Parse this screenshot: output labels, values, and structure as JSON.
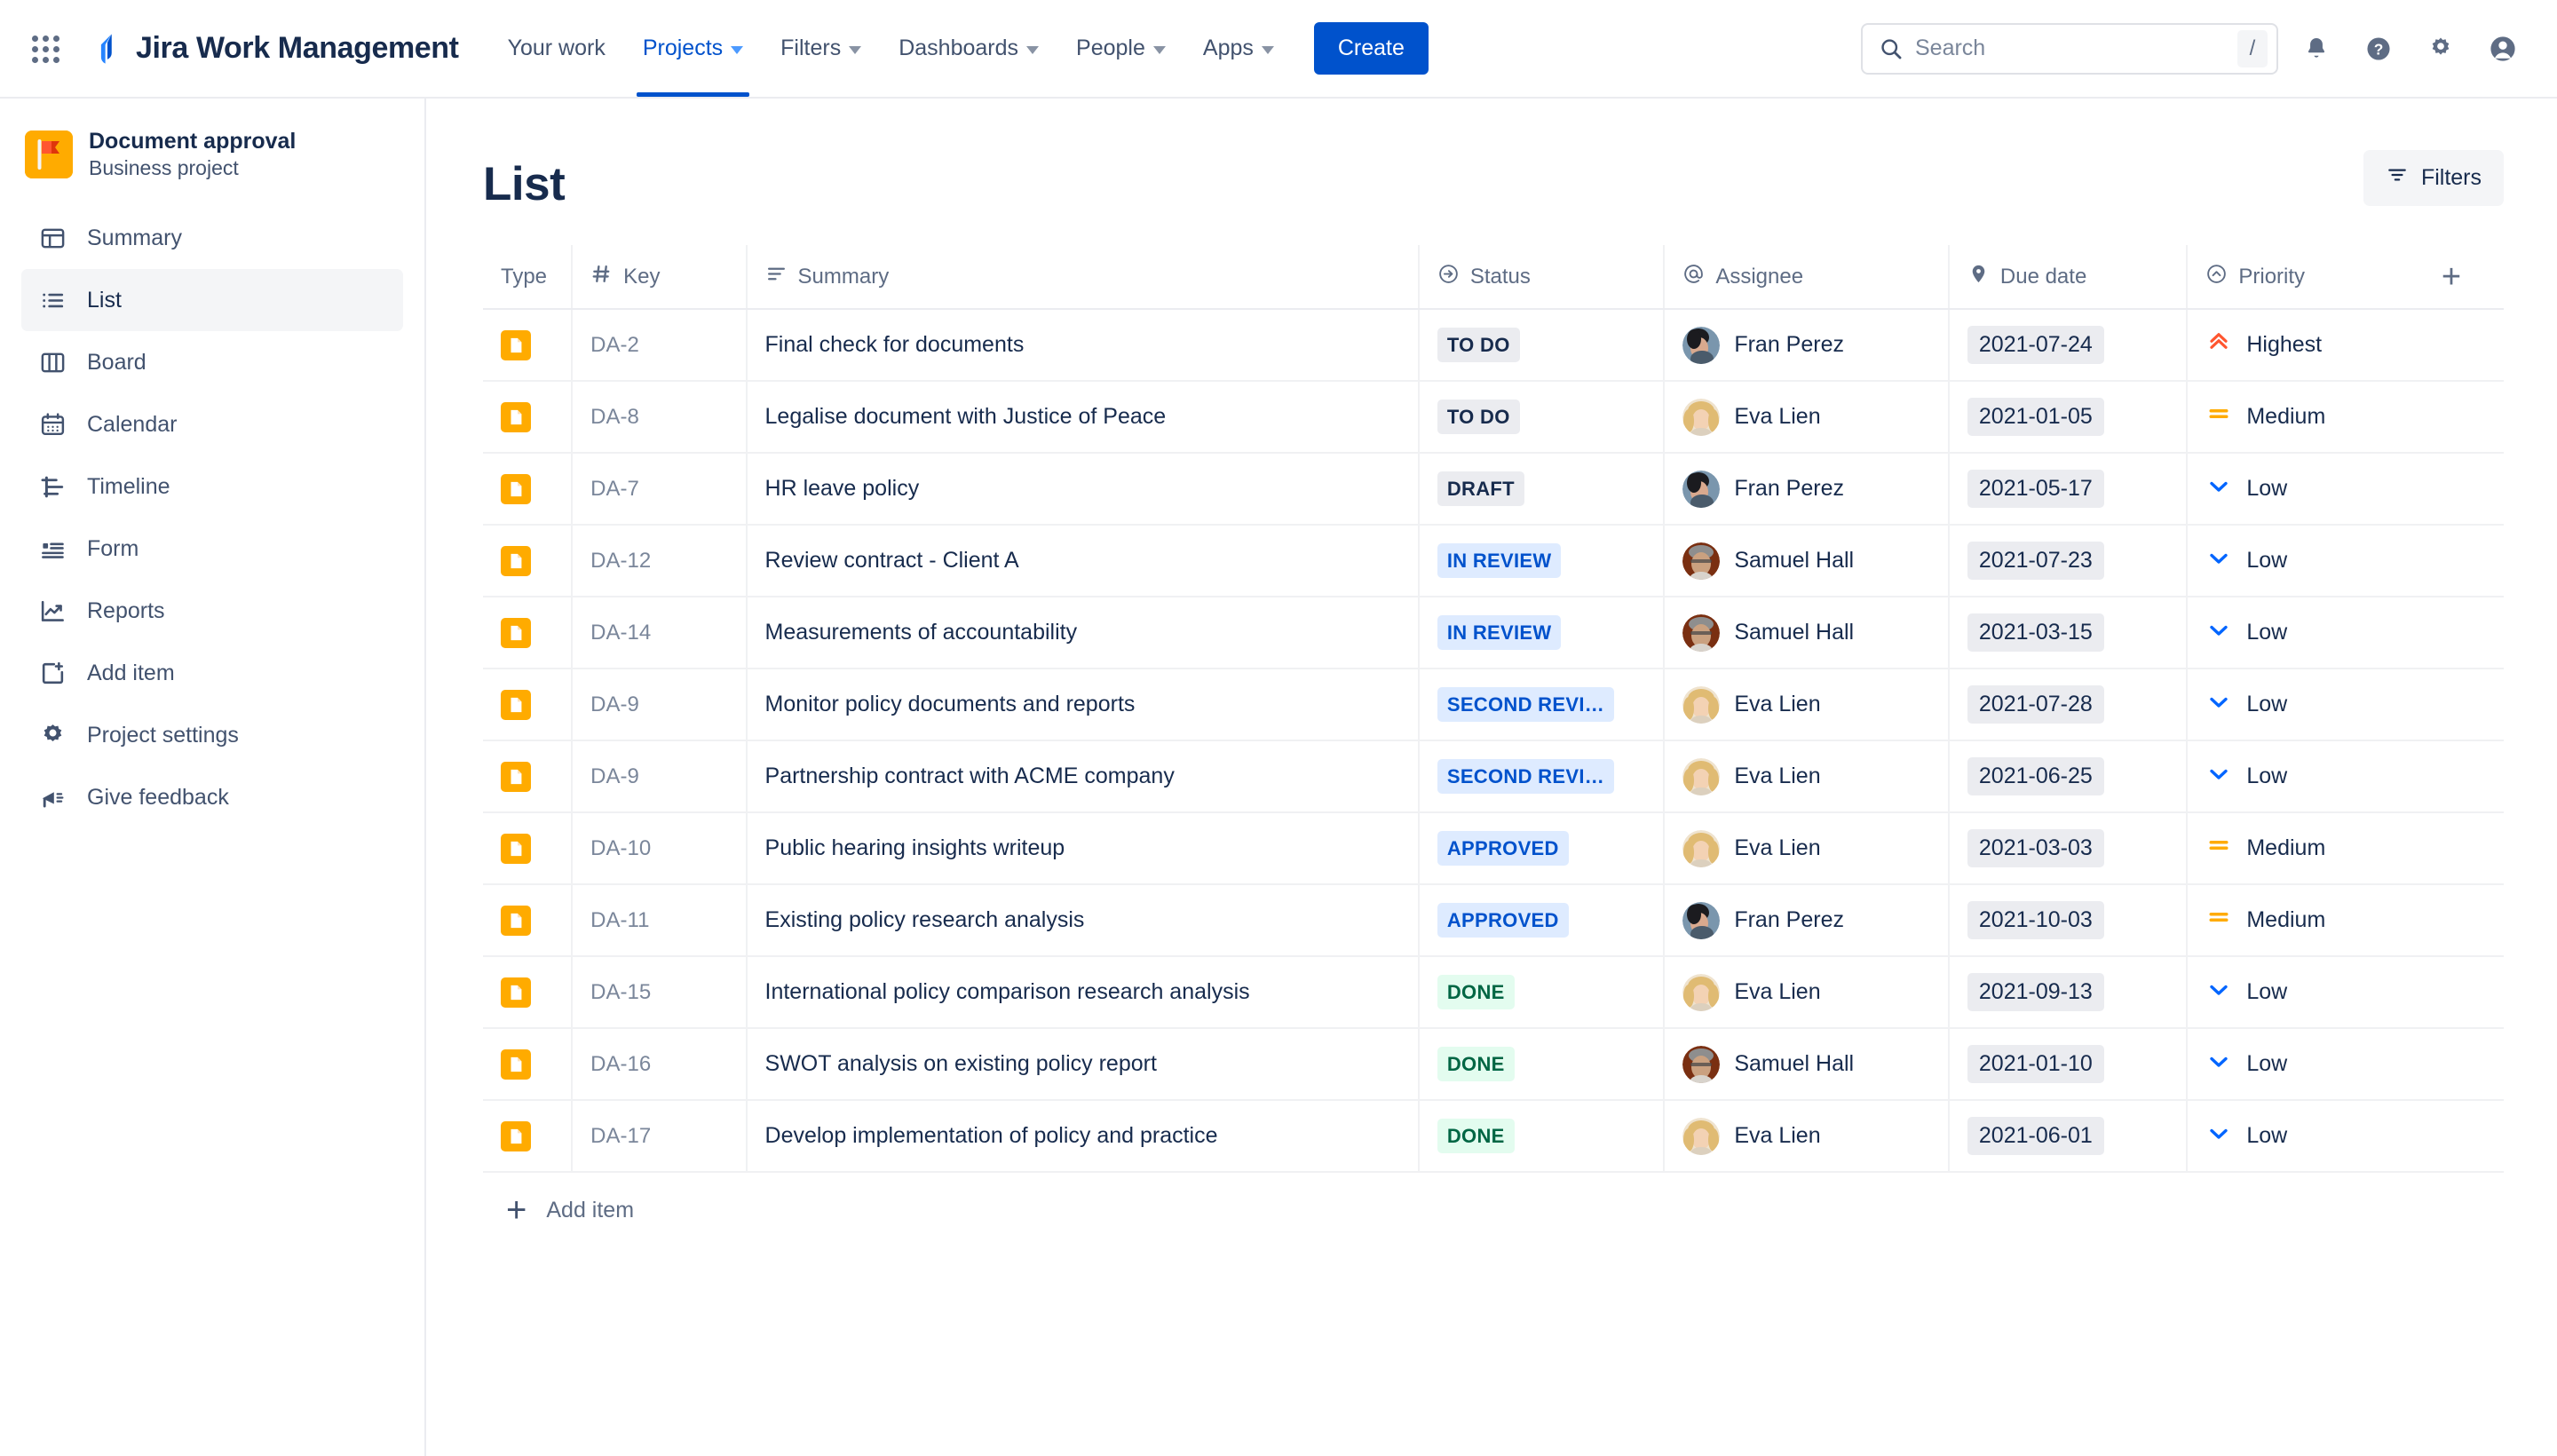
{
  "topnav": {
    "app_switcher_icon": "grid-apps-icon",
    "brand": "Jira Work Management",
    "brand_icon": "jira-logo-icon",
    "items": [
      {
        "label": "Your work",
        "has_caret": false,
        "active": false
      },
      {
        "label": "Projects",
        "has_caret": true,
        "active": true
      },
      {
        "label": "Filters",
        "has_caret": true,
        "active": false
      },
      {
        "label": "Dashboards",
        "has_caret": true,
        "active": false
      },
      {
        "label": "People",
        "has_caret": true,
        "active": false
      },
      {
        "label": "Apps",
        "has_caret": true,
        "active": false
      }
    ],
    "create_label": "Create",
    "search": {
      "placeholder": "Search",
      "value": "",
      "icon": "search-icon",
      "shortcut": "/"
    },
    "right_icons": [
      {
        "name": "notifications-bell-icon"
      },
      {
        "name": "help-question-icon"
      },
      {
        "name": "settings-gear-icon"
      },
      {
        "name": "profile-avatar-icon"
      }
    ]
  },
  "sidebar": {
    "project": {
      "name": "Document approval",
      "type": "Business project",
      "avatar_icon": "red-flag-icon",
      "avatar_bg": "#ffab00"
    },
    "items": [
      {
        "label": "Summary",
        "icon": "summary-window-icon",
        "selected": false
      },
      {
        "label": "List",
        "icon": "list-bullets-icon",
        "selected": true
      },
      {
        "label": "Board",
        "icon": "board-columns-icon",
        "selected": false
      },
      {
        "label": "Calendar",
        "icon": "calendar-icon",
        "selected": false
      },
      {
        "label": "Timeline",
        "icon": "timeline-bars-icon",
        "selected": false
      },
      {
        "label": "Form",
        "icon": "form-icon",
        "selected": false
      },
      {
        "label": "Reports",
        "icon": "reports-chart-icon",
        "selected": false
      },
      {
        "label": "Add item",
        "icon": "add-page-plus-icon",
        "selected": false
      },
      {
        "label": "Project settings",
        "icon": "gear-icon",
        "selected": false
      },
      {
        "label": "Give feedback",
        "icon": "megaphone-icon",
        "selected": false
      }
    ]
  },
  "main": {
    "title": "List",
    "filters_button": {
      "label": "Filters",
      "icon": "filter-icon"
    },
    "add_item_row": {
      "label": "Add item",
      "icon": "plus-icon"
    },
    "add_column_icon": "plus-icon",
    "columns": [
      {
        "key": "type",
        "label": "Type",
        "icon": null
      },
      {
        "key": "key",
        "label": "Key",
        "icon": "hash-icon"
      },
      {
        "key": "summary",
        "label": "Summary",
        "icon": "text-lines-icon"
      },
      {
        "key": "status",
        "label": "Status",
        "icon": "arrow-circle-icon"
      },
      {
        "key": "assignee",
        "label": "Assignee",
        "icon": "at-sign-icon"
      },
      {
        "key": "due",
        "label": "Due date",
        "icon": "tag-icon"
      },
      {
        "key": "priority",
        "label": "Priority",
        "icon": "chevron-circle-up-icon"
      }
    ],
    "rows": [
      {
        "type_icon": "document-icon",
        "key": "DA-2",
        "summary": "Final check for documents",
        "status": "TO DO",
        "status_tone": "gray",
        "assignee": "Fran Perez",
        "avatar": "fran-perez-avatar",
        "due": "2021-07-24",
        "priority": "Highest",
        "priority_icon": "priority-highest-icon"
      },
      {
        "type_icon": "document-icon",
        "key": "DA-8",
        "summary": "Legalise document with Justice of Peace",
        "status": "TO DO",
        "status_tone": "gray",
        "assignee": "Eva Lien",
        "avatar": "eva-lien-avatar",
        "due": "2021-01-05",
        "priority": "Medium",
        "priority_icon": "priority-medium-icon"
      },
      {
        "type_icon": "document-icon",
        "key": "DA-7",
        "summary": "HR leave policy",
        "status": "DRAFT",
        "status_tone": "gray",
        "assignee": "Fran Perez",
        "avatar": "fran-perez-avatar",
        "due": "2021-05-17",
        "priority": "Low",
        "priority_icon": "priority-low-icon"
      },
      {
        "type_icon": "document-icon",
        "key": "DA-12",
        "summary": "Review contract - Client A",
        "status": "IN REVIEW",
        "status_tone": "blue",
        "assignee": "Samuel Hall",
        "avatar": "samuel-hall-avatar",
        "due": "2021-07-23",
        "priority": "Low",
        "priority_icon": "priority-low-icon"
      },
      {
        "type_icon": "document-icon",
        "key": "DA-14",
        "summary": "Measurements of accountability",
        "status": "IN REVIEW",
        "status_tone": "blue",
        "assignee": "Samuel Hall",
        "avatar": "samuel-hall-avatar",
        "due": "2021-03-15",
        "priority": "Low",
        "priority_icon": "priority-low-icon"
      },
      {
        "type_icon": "document-icon",
        "key": "DA-9",
        "summary": "Monitor policy documents and reports",
        "status": "SECOND REVI…",
        "status_tone": "blue",
        "assignee": "Eva Lien",
        "avatar": "eva-lien-avatar",
        "due": "2021-07-28",
        "priority": "Low",
        "priority_icon": "priority-low-icon"
      },
      {
        "type_icon": "document-icon",
        "key": "DA-9",
        "summary": "Partnership contract with ACME company",
        "status": "SECOND REVI…",
        "status_tone": "blue",
        "assignee": "Eva Lien",
        "avatar": "eva-lien-avatar",
        "due": "2021-06-25",
        "priority": "Low",
        "priority_icon": "priority-low-icon"
      },
      {
        "type_icon": "document-icon",
        "key": "DA-10",
        "summary": "Public hearing insights writeup",
        "status": "APPROVED",
        "status_tone": "blue",
        "assignee": "Eva Lien",
        "avatar": "eva-lien-avatar",
        "due": "2021-03-03",
        "priority": "Medium",
        "priority_icon": "priority-medium-icon"
      },
      {
        "type_icon": "document-icon",
        "key": "DA-11",
        "summary": "Existing policy research analysis",
        "status": "APPROVED",
        "status_tone": "blue",
        "assignee": "Fran Perez",
        "avatar": "fran-perez-avatar",
        "due": "2021-10-03",
        "priority": "Medium",
        "priority_icon": "priority-medium-icon"
      },
      {
        "type_icon": "document-icon",
        "key": "DA-15",
        "summary": "International policy comparison research analysis",
        "status": "DONE",
        "status_tone": "green",
        "assignee": "Eva Lien",
        "avatar": "eva-lien-avatar",
        "due": "2021-09-13",
        "priority": "Low",
        "priority_icon": "priority-low-icon"
      },
      {
        "type_icon": "document-icon",
        "key": "DA-16",
        "summary": "SWOT analysis on existing policy report",
        "status": "DONE",
        "status_tone": "green",
        "assignee": "Samuel Hall",
        "avatar": "samuel-hall-avatar",
        "due": "2021-01-10",
        "priority": "Low",
        "priority_icon": "priority-low-icon"
      },
      {
        "type_icon": "document-icon",
        "key": "DA-17",
        "summary": "Develop implementation of policy and practice",
        "status": "DONE",
        "status_tone": "green",
        "assignee": "Eva Lien",
        "avatar": "eva-lien-avatar",
        "due": "2021-06-01",
        "priority": "Low",
        "priority_icon": "priority-low-icon"
      }
    ]
  },
  "colors": {
    "brand_blue": "#0052cc",
    "text_primary": "#172b4d",
    "text_subtle": "#5e6c84",
    "type_amber": "#ffab00",
    "priority_highest": "#ff5630",
    "priority_medium": "#ffab00",
    "priority_low": "#0065ff",
    "status_green": "#006644",
    "border": "#ebecf0"
  }
}
